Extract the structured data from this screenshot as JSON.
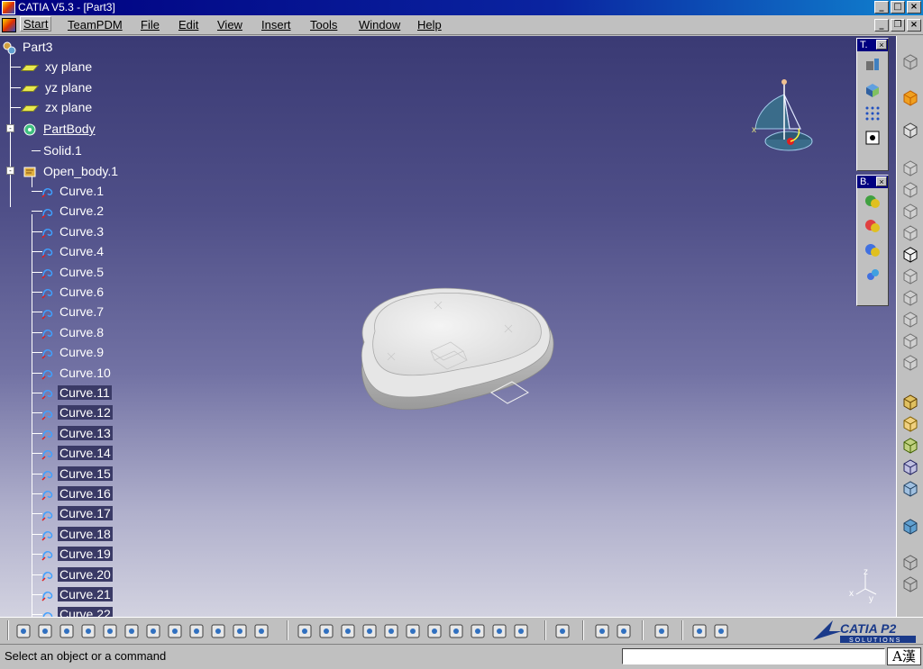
{
  "window": {
    "title": "CATIA V5.3 - [Part3]",
    "min": "_",
    "max": "□",
    "close": "×"
  },
  "menu": [
    "Start",
    "TeamPDM",
    "File",
    "Edit",
    "View",
    "Insert",
    "Tools",
    "Window",
    "Help"
  ],
  "doc_controls": {
    "min": "_",
    "restore": "❐",
    "close": "×"
  },
  "tree": {
    "root": "Part3",
    "planes": [
      "xy plane",
      "yz plane",
      "zx plane"
    ],
    "part_body": "PartBody",
    "solid": "Solid.1",
    "open_body": "Open_body.1",
    "curves": [
      {
        "label": "Curve.1",
        "selected": false
      },
      {
        "label": "Curve.2",
        "selected": false
      },
      {
        "label": "Curve.3",
        "selected": false
      },
      {
        "label": "Curve.4",
        "selected": false
      },
      {
        "label": "Curve.5",
        "selected": false
      },
      {
        "label": "Curve.6",
        "selected": false
      },
      {
        "label": "Curve.7",
        "selected": false
      },
      {
        "label": "Curve.8",
        "selected": false
      },
      {
        "label": "Curve.9",
        "selected": false
      },
      {
        "label": "Curve.10",
        "selected": false
      },
      {
        "label": "Curve.11",
        "selected": true
      },
      {
        "label": "Curve.12",
        "selected": true
      },
      {
        "label": "Curve.13",
        "selected": true
      },
      {
        "label": "Curve.14",
        "selected": true
      },
      {
        "label": "Curve.15",
        "selected": true
      },
      {
        "label": "Curve.16",
        "selected": true
      },
      {
        "label": "Curve.17",
        "selected": true
      },
      {
        "label": "Curve.18",
        "selected": true
      },
      {
        "label": "Curve.19",
        "selected": true
      },
      {
        "label": "Curve.20",
        "selected": true
      },
      {
        "label": "Curve.21",
        "selected": true
      },
      {
        "label": "Curve.22",
        "selected": true
      }
    ]
  },
  "floating_toolbars": [
    {
      "title": "T.",
      "close": "×",
      "icons": [
        "render-style-icon",
        "view-mode-icon",
        "grid-icon",
        "snap-point-icon"
      ]
    },
    {
      "title": "B.",
      "close": "×",
      "icons": [
        "boolean-assemble-icon",
        "boolean-add-icon",
        "boolean-remove-icon",
        "boolean-intersect-icon"
      ]
    }
  ],
  "compass_axes": {
    "x": "x",
    "y": "y",
    "z": "z"
  },
  "axis_triad": {
    "x": "x",
    "y": "y",
    "z": "z"
  },
  "status": {
    "message": "Select an object or a command",
    "command_input": "",
    "ime": "A漢"
  },
  "logo": {
    "brand": "CATIA P2",
    "sub": "SOLUTIONS"
  },
  "colors": {
    "titlebar": "#000080",
    "viewport_top": "#3a3a74",
    "viewport_bottom": "#d2d2e0",
    "selection": "#3a3a66"
  }
}
